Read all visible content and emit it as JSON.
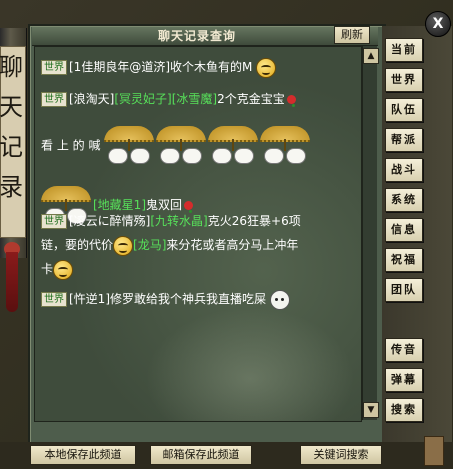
{
  "window": {
    "title": "聊天记录查询",
    "refresh_label": "刷新",
    "close_glyph": "X"
  },
  "scroll_decoration": {
    "chars": [
      "聊",
      "天",
      "记",
      "录"
    ]
  },
  "channel_tabs": [
    {
      "label": "当前"
    },
    {
      "label": "世界"
    },
    {
      "label": "队伍"
    },
    {
      "label": "帮派"
    },
    {
      "label": "战斗"
    },
    {
      "label": "系统"
    },
    {
      "label": "信息"
    },
    {
      "label": "祝福"
    },
    {
      "label": "团队"
    },
    {
      "label": "传音"
    },
    {
      "label": "弹幕"
    },
    {
      "label": "搜索"
    }
  ],
  "messages": [
    {
      "channel": "世界",
      "sender": "[1佳期良年@道济]",
      "text": "收个木鱼有的M"
    },
    {
      "channel": "世界",
      "sender": "[浪淘天]",
      "tag1": "[冥灵妃子]",
      "tag2": "[冰雪魔]",
      "text": "2个克金宝宝"
    },
    {
      "prefix": "看 上 的 喊"
    },
    {
      "sender": "[地藏星1]",
      "text": "鬼双回"
    },
    {
      "channel": "世界",
      "sender": "[凌云に醉情殇]",
      "tag1": "[九转水晶]",
      "text": "克火26狂暴+6项"
    },
    {
      "text": "链，要的代价",
      "tag1": "[龙马]",
      "text2": "来分花或者高分马上冲年"
    },
    {
      "text": "卡"
    },
    {
      "channel": "世界",
      "sender": "[忤逆1]",
      "text": "修罗敢给我个神兵我直播吃屎"
    }
  ],
  "bottom_buttons": {
    "save_local": "本地保存此频道",
    "save_mail": "邮箱保存此频道",
    "keyword_search": "关键词搜索"
  },
  "scrollbar": {
    "up": "▲",
    "down": "▼"
  }
}
